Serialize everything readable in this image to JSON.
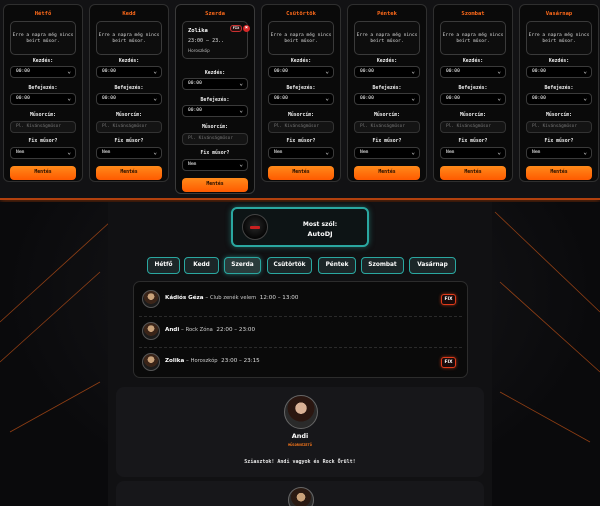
{
  "days": [
    {
      "name": "Hétfő",
      "empty_text": "Erre a napra még nincs beírt műsor.",
      "start_label": "Kezdés:",
      "start_value": "00:00",
      "end_label": "Befejezés:",
      "end_value": "00:00",
      "show_label": "Műsorcím:",
      "show_placeholder": "Pl. Kívánságműsor",
      "fix_label": "Fix műsor?",
      "fix_value": "Nem",
      "save_label": "Mentés"
    },
    {
      "name": "Kedd",
      "empty_text": "Erre a napra még nincs beírt műsor.",
      "start_label": "Kezdés:",
      "start_value": "00:00",
      "end_label": "Befejezés:",
      "end_value": "00:00",
      "show_label": "Műsorcím:",
      "show_placeholder": "Pl. Kívánságműsor",
      "fix_label": "Fix műsor?",
      "fix_value": "Nem",
      "save_label": "Mentés"
    },
    {
      "name": "Szerda",
      "show_name": "Zolika",
      "show_time": "23:00 – 23..",
      "show_sub": "Horoszkóp",
      "fix_badge": "FIX",
      "delete_glyph": "✖",
      "start_label": "Kezdés:",
      "start_value": "00:00",
      "end_label": "Befejezés:",
      "end_value": "00:00",
      "show_label": "Műsorcím:",
      "show_placeholder": "Pl. Kívánságműsor",
      "fix_label": "Fix műsor?",
      "fix_value": "Nem",
      "save_label": "Mentés"
    },
    {
      "name": "Csütörtök",
      "empty_text": "Erre a napra még nincs beírt műsor.",
      "start_label": "Kezdés:",
      "start_value": "00:00",
      "end_label": "Befejezés:",
      "end_value": "00:00",
      "show_label": "Műsorcím:",
      "show_placeholder": "Pl. Kívánságműsor",
      "fix_label": "Fix műsor?",
      "fix_value": "Nem",
      "save_label": "Mentés"
    },
    {
      "name": "Péntek",
      "empty_text": "Erre a napra még nincs beírt műsor.",
      "start_label": "Kezdés:",
      "start_value": "00:00",
      "end_label": "Befejezés:",
      "end_value": "00:00",
      "show_label": "Műsorcím:",
      "show_placeholder": "Pl. Kívánságműsor",
      "fix_label": "Fix műsor?",
      "fix_value": "Nem",
      "save_label": "Mentés"
    },
    {
      "name": "Szombat",
      "empty_text": "Erre a napra még nincs beírt műsor.",
      "start_label": "Kezdés:",
      "start_value": "00:00",
      "end_label": "Befejezés:",
      "end_value": "00:00",
      "show_label": "Műsorcím:",
      "show_placeholder": "Pl. Kívánságműsor",
      "fix_label": "Fix műsor?",
      "fix_value": "Nem",
      "save_label": "Mentés"
    },
    {
      "name": "Vasárnap",
      "empty_text": "Erre a napra még nincs beírt műsor.",
      "start_label": "Kezdés:",
      "start_value": "00:00",
      "end_label": "Befejezés:",
      "end_value": "00:00",
      "show_label": "Műsorcím:",
      "show_placeholder": "Pl. Kívánságműsor",
      "fix_label": "Fix műsor?",
      "fix_value": "Nem",
      "save_label": "Mentés"
    }
  ],
  "now_playing": {
    "label": "Most szól:",
    "value": "AutoDJ"
  },
  "tabs": [
    "Hétfő",
    "Kedd",
    "Szerda",
    "Csütörtök",
    "Péntek",
    "Szombat",
    "Vasárnap"
  ],
  "active_tab": "Szerda",
  "schedule": [
    {
      "host": "Kádiós Géza",
      "genre": "Club zenék velem",
      "time": "12:00 – 13:00",
      "fix": "FIX"
    },
    {
      "host": "Andi",
      "genre": "Rock Zóna",
      "time": "22:00 – 23:00",
      "fix": ""
    },
    {
      "host": "Zolika",
      "genre": "Horoszkóp",
      "time": "23:00 – 23:15",
      "fix": "FIX"
    }
  ],
  "host": {
    "name": "Andi",
    "role": "MŰSORVEZETŐ",
    "bio": "Sziasztok! Andi vagyok és Rock Őrült!"
  },
  "colors": {
    "accent": "#ff6a1a",
    "teal": "#2aa7a0",
    "danger": "#d82828"
  }
}
